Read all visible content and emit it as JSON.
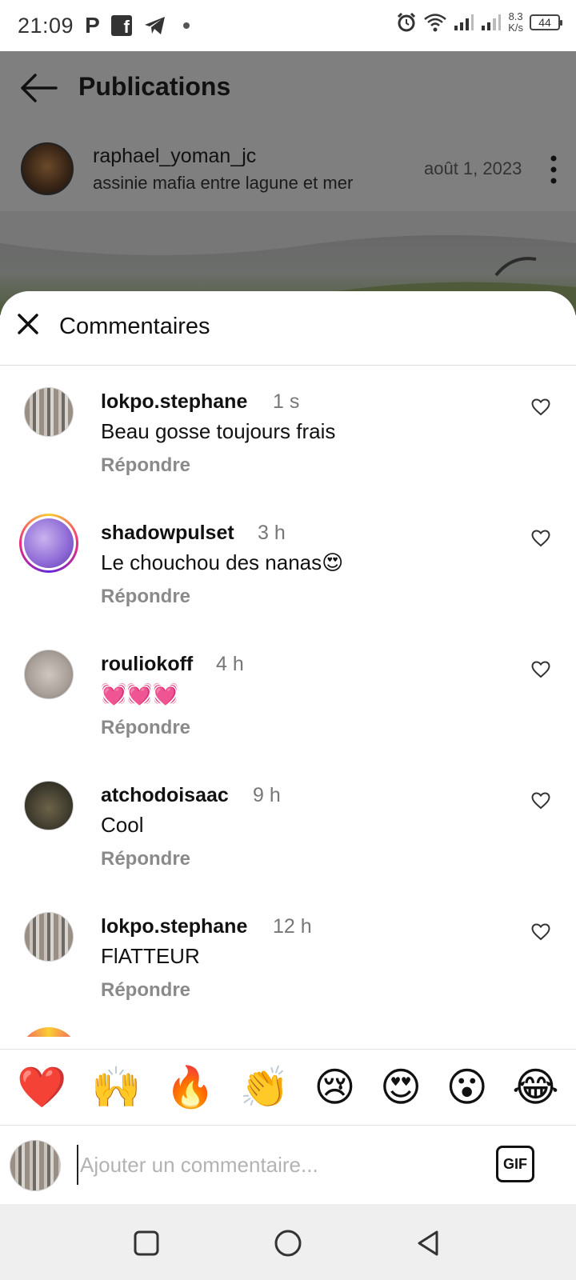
{
  "status_bar": {
    "time": "21:09",
    "network_speed_value": "8.3",
    "network_speed_unit": "K/s",
    "battery": "44",
    "icons": [
      "p-icon",
      "facebook-icon",
      "telegram-icon",
      "dot-icon",
      "alarm-icon",
      "wifi-icon",
      "signal-icon",
      "signal-icon-2",
      "battery-icon"
    ]
  },
  "header": {
    "title": "Publications"
  },
  "post": {
    "author": "raphael_yoman_jc",
    "location": "assinie mafia entre lagune et mer",
    "date": "août 1, 2023"
  },
  "comments_sheet": {
    "title": "Commentaires",
    "reply_label": "Répondre",
    "comments": [
      {
        "user": "lokpo.stephane",
        "time": "1 s",
        "text": "Beau gosse toujours frais"
      },
      {
        "user": "shadowpulset",
        "time": "3 h",
        "text": "Le chouchou des nanas😍"
      },
      {
        "user": "rouliokoff",
        "time": "4 h",
        "text": "💓💓💓"
      },
      {
        "user": "atchodoisaac",
        "time": "9 h",
        "text": "Cool"
      },
      {
        "user": "lokpo.stephane",
        "time": "12 h",
        "text": "FlATTEUR"
      }
    ]
  },
  "emoji_bar": [
    "❤️",
    "🙌",
    "🔥",
    "👏",
    "😢",
    "😍",
    "😮",
    "😂"
  ],
  "comment_input": {
    "placeholder": "Ajouter un commentaire...",
    "gif_label": "GIF"
  },
  "colors": {
    "dim_overlay": "#7f7f7f",
    "secondary_text": "#8a8a8a",
    "story_ring": "#ee2a7b"
  }
}
